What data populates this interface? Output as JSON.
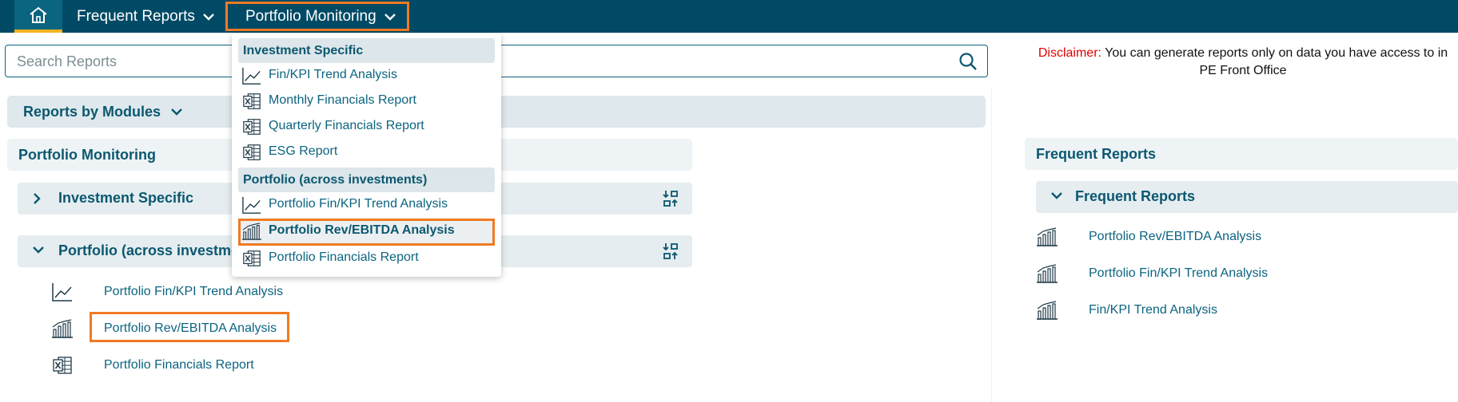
{
  "nav": {
    "frequent_reports": "Frequent Reports",
    "portfolio_monitoring": "Portfolio Monitoring"
  },
  "search": {
    "placeholder": "Search Reports"
  },
  "disclaimer": {
    "label": "Disclaimer:",
    "text": " You can generate reports only on data you have access to in PE Front Office"
  },
  "modules": {
    "label": "Reports by Modules"
  },
  "portfolio_monitoring": {
    "title": "Portfolio Monitoring",
    "investment_specific": "Investment Specific",
    "portfolio_across": "Portfolio (across investments)",
    "items": [
      {
        "label": "Portfolio Fin/KPI Trend Analysis",
        "icon": "line-chart-icon"
      },
      {
        "label": "Portfolio Rev/EBITDA Analysis",
        "icon": "bar-chart-icon"
      },
      {
        "label": "Portfolio Financials Report",
        "icon": "excel-icon"
      }
    ]
  },
  "frequent_reports": {
    "title": "Frequent Reports",
    "sub_title": "Frequent Reports",
    "items": [
      {
        "label": "Portfolio Rev/EBITDA Analysis",
        "icon": "bar-chart-icon"
      },
      {
        "label": "Portfolio Fin/KPI Trend Analysis",
        "icon": "bar-chart-icon"
      },
      {
        "label": "Fin/KPI Trend Analysis",
        "icon": "bar-chart-icon"
      }
    ]
  },
  "dropdown": {
    "group_investment": "Investment Specific",
    "investment_items": [
      {
        "label": "Fin/KPI Trend Analysis",
        "icon": "line-chart-icon"
      },
      {
        "label": "Monthly Financials Report",
        "icon": "excel-icon"
      },
      {
        "label": "Quarterly Financials Report",
        "icon": "excel-icon"
      },
      {
        "label": "ESG Report",
        "icon": "excel-icon"
      }
    ],
    "group_portfolio": "Portfolio (across investments)",
    "portfolio_items": [
      {
        "label": "Portfolio Fin/KPI Trend Analysis",
        "icon": "line-chart-icon"
      },
      {
        "label": "Portfolio Rev/EBITDA Analysis",
        "icon": "bar-chart-icon"
      },
      {
        "label": "Portfolio Financials Report",
        "icon": "excel-icon"
      }
    ]
  },
  "colors": {
    "topbar": "#004a66",
    "accent": "#f07a22",
    "text": "#0b5870",
    "disclaimer_label": "#e00000"
  }
}
